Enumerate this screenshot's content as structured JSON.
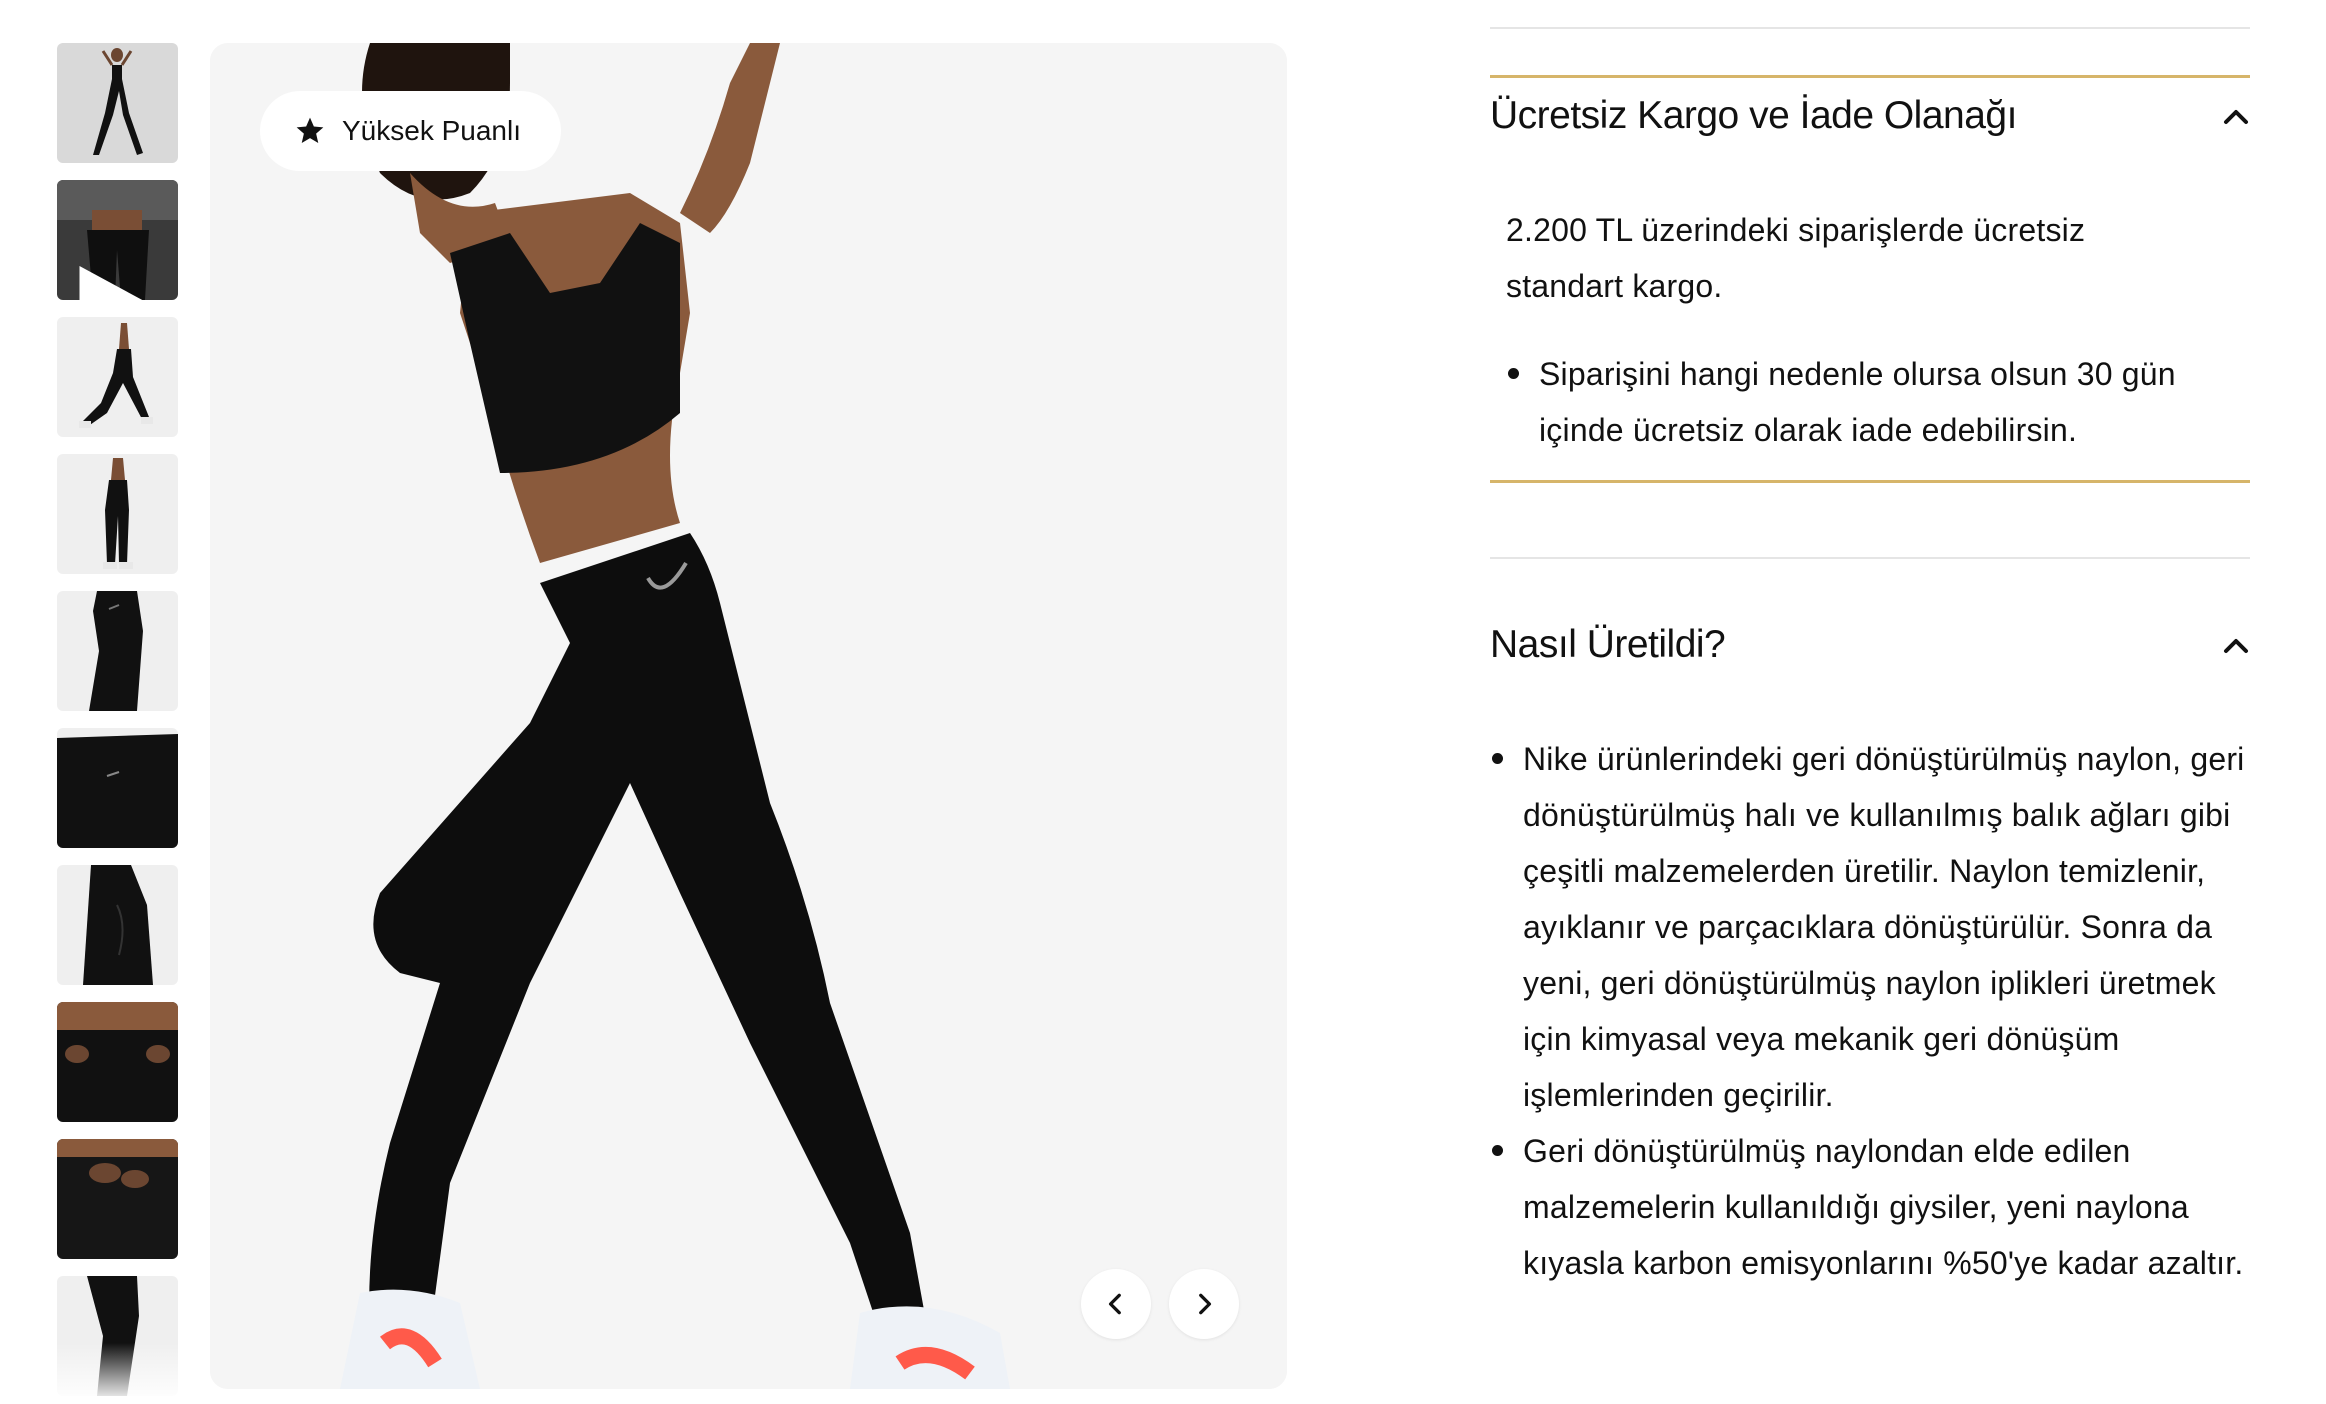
{
  "gallery": {
    "badge_label": "Yüksek Puanlı",
    "badge_icon": "star-icon",
    "prev_icon": "chevron-left-icon",
    "next_icon": "chevron-right-icon",
    "thumbnail_count": 10,
    "video_thumbnail_icon": "play-icon"
  },
  "shipping": {
    "title": "Ücretsiz Kargo ve İade Olanağı",
    "expanded": true,
    "intro": "2.200 TL üzerindeki siparişlerde ücretsiz standart kargo.",
    "bullets": [
      "Siparişini hangi nedenle olursa olsun 30 gün içinde ücretsiz olarak iade edebilirsin."
    ]
  },
  "made": {
    "title": "Nasıl Üretildi?",
    "expanded": true,
    "bullets": [
      "Nike ürünlerindeki geri dönüştürülmüş naylon, geri dönüştürülmüş halı ve kullanılmış balık ağları gibi çeşitli malzemelerden üretilir. Naylon temizlenir, ayıklanır ve parçacıklara dönüştürülür. Sonra da yeni, geri dönüştürülmüş naylon iplikleri üretmek için kimyasal veya mekanik geri dönüşüm işlemlerinden geçirilir.",
      "Geri dönüştürülmüş naylondan elde edilen malzemelerin kullanıldığı giysiler, yeni naylona kıyasla karbon emisyonlarını %50'ye kadar azaltır."
    ]
  },
  "colors": {
    "focus_border": "#d6b56a",
    "divider": "#e5e5e5",
    "image_background": "#f5f5f5",
    "garment": "#0d0d0d",
    "skin": "#8a5a3c"
  }
}
